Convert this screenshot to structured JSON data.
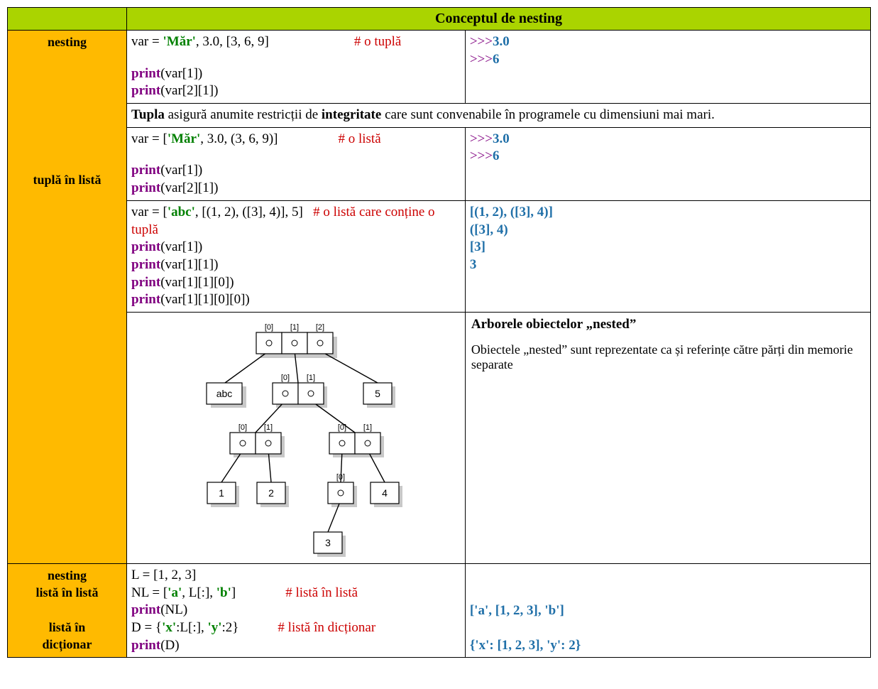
{
  "header": {
    "title": "Conceptul de nesting"
  },
  "rows": {
    "r1": "nesting",
    "r2a": "tuplă în listă",
    "r3a": "nesting",
    "r3b": "listă în listă",
    "r3c": "listă în",
    "r3d": "dicționar"
  },
  "ex1": {
    "assign_pre": "var = ",
    "str": "'Măr'",
    "assign_post": ", 3.0, [3, 6, 9]",
    "cmt": "# o tuplă",
    "p1_pre": "print",
    "p1_arg": "(var[1])",
    "p2_pre": "print",
    "p2_arg": "(var[2][1])",
    "out1_p": ">>>",
    "out1_v": "3.0",
    "out2_p": ">>>",
    "out2_v": "6"
  },
  "tupla_text": {
    "a": "Tupla",
    "b": " asigură anumite restricții de ",
    "c": "integritate",
    "d": " care sunt convenabile în programele cu dimensiuni mai mari."
  },
  "ex2": {
    "assign_pre": "var = [",
    "str": "'Măr'",
    "assign_post": ", 3.0, (3, 6, 9)]",
    "cmt": "# o listă",
    "p1_pre": "print",
    "p1_arg": "(var[1])",
    "p2_pre": "print",
    "p2_arg": "(var[2][1])",
    "out1_p": ">>>",
    "out1_v": "3.0",
    "out2_p": ">>>",
    "out2_v": "6"
  },
  "ex3": {
    "assign_pre": "var = [",
    "str": "'abc'",
    "assign_post": ", [(1, 2), ([3], 4)], 5]",
    "cmt": "# o listă care conține o tuplă",
    "p1_pre": "print",
    "p1_arg": "(var[1])",
    "p2_pre": "print",
    "p2_arg": "(var[1][1])",
    "p3_pre": "print",
    "p3_arg": "(var[1][1][0])",
    "p4_pre": "print",
    "p4_arg": "(var[1][1][0][0])",
    "o1": "[(1, 2), ([3], 4)]",
    "o2": "([3], 4)",
    "o3": "[3]",
    "o4": "3"
  },
  "tree": {
    "title": "Arborele obiectelor „nested”",
    "desc": "Obiectele „nested” sunt reprezentate ca și referințe către părți din memorie separate",
    "idx0": "[0]",
    "idx1": "[1]",
    "idx2": "[2]",
    "abc": "abc",
    "v1": "1",
    "v2": "2",
    "v3": "3",
    "v4": "4",
    "v5": "5"
  },
  "ex4": {
    "l1": "L = [1, 2, 3]",
    "l2_pre": "NL = [",
    "l2_s1": "'a'",
    "l2_mid": ", L[:], ",
    "l2_s2": "'b'",
    "l2_post": "]",
    "l2_cmt": "# listă în listă",
    "l3_pre": "print",
    "l3_arg": "(NL)",
    "l4_pre": "D = {",
    "l4_s1": "'x'",
    "l4_mid": ":L[:], ",
    "l4_s2": "'y'",
    "l4_post": ":2}",
    "l4_cmt": "# listă în dicționar",
    "l5_pre": "print",
    "l5_arg": "(D)",
    "o1": "['a', [1, 2, 3], 'b']",
    "o2": "{'x': [1, 2, 3], 'y': 2}"
  }
}
